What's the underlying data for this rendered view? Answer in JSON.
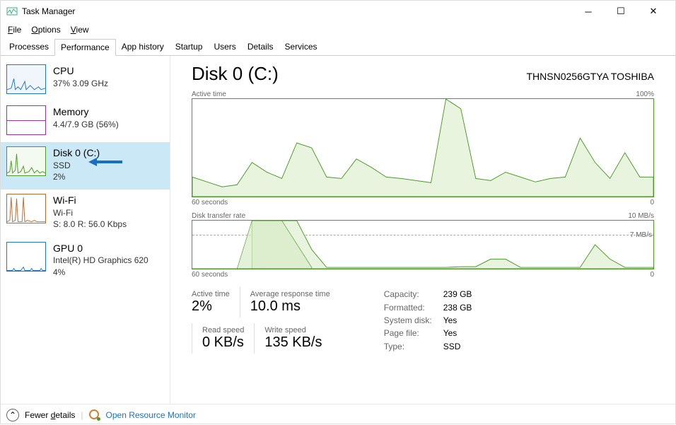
{
  "window": {
    "title": "Task Manager",
    "menus": {
      "file": "File",
      "options": "Options",
      "view": "View"
    }
  },
  "tabs": [
    "Processes",
    "Performance",
    "App history",
    "Startup",
    "Users",
    "Details",
    "Services"
  ],
  "activeTab": "Performance",
  "sidebar": [
    {
      "id": "cpu",
      "title": "CPU",
      "line1": "37%  3.09 GHz",
      "line2": "",
      "color": "#2176c5"
    },
    {
      "id": "memory",
      "title": "Memory",
      "line1": "4.4/7.9 GB (56%)",
      "line2": "",
      "color": "#9435a6"
    },
    {
      "id": "disk0",
      "title": "Disk 0 (C:)",
      "line1": "SSD",
      "line2": "2%",
      "color": "#4c9a2a",
      "selected": true
    },
    {
      "id": "wifi",
      "title": "Wi-Fi",
      "line1": "Wi-Fi",
      "line2": "S: 8.0  R: 56.0 Kbps",
      "color": "#b56c32"
    },
    {
      "id": "gpu0",
      "title": "GPU 0",
      "line1": "Intel(R) HD Graphics 620",
      "line2": "4%",
      "color": "#2176c5"
    }
  ],
  "main": {
    "title": "Disk 0 (C:)",
    "model": "THNSN0256GTYA TOSHIBA",
    "chart1": {
      "topLeft": "Active time",
      "topRight": "100%",
      "bottomLeft": "60 seconds",
      "bottomRight": "0"
    },
    "chart2": {
      "topLeft": "Disk transfer rate",
      "topRight": "10 MB/s",
      "midRight": "7 MB/s",
      "bottomLeft": "60 seconds",
      "bottomRight": "0"
    },
    "stats1": [
      {
        "label": "Active time",
        "value": "2%"
      },
      {
        "label": "Average response time",
        "value": "10.0 ms"
      }
    ],
    "stats2": [
      {
        "label": "Read speed",
        "value": "0 KB/s"
      },
      {
        "label": "Write speed",
        "value": "135 KB/s"
      }
    ],
    "props": [
      {
        "k": "Capacity:",
        "v": "239 GB"
      },
      {
        "k": "Formatted:",
        "v": "238 GB"
      },
      {
        "k": "System disk:",
        "v": "Yes"
      },
      {
        "k": "Page file:",
        "v": "Yes"
      },
      {
        "k": "Type:",
        "v": "SSD"
      }
    ]
  },
  "footer": {
    "fewer": "Fewer details",
    "resmon": "Open Resource Monitor"
  },
  "chart_data": [
    {
      "type": "area",
      "title": "Active time",
      "xlabel": "seconds",
      "ylabel": "Active time (%)",
      "xlim": [
        60,
        0
      ],
      "ylim": [
        0,
        100
      ],
      "x_seconds_ago": [
        60,
        58,
        56,
        54,
        52,
        50,
        48,
        46,
        44,
        42,
        40,
        38,
        36,
        34,
        32,
        30,
        28,
        26,
        24,
        22,
        20,
        18,
        16,
        14,
        12,
        10,
        8,
        6,
        4,
        2,
        0
      ],
      "values_pct": [
        20,
        15,
        10,
        12,
        35,
        25,
        18,
        55,
        50,
        20,
        18,
        38,
        30,
        20,
        18,
        16,
        14,
        100,
        90,
        18,
        16,
        25,
        20,
        15,
        18,
        20,
        60,
        35,
        18,
        45,
        20
      ]
    },
    {
      "type": "area",
      "title": "Disk transfer rate",
      "xlabel": "seconds",
      "ylabel": "MB/s",
      "xlim": [
        60,
        0
      ],
      "ylim": [
        0,
        10
      ],
      "reference_line": 7,
      "series": [
        {
          "name": "read",
          "values_mbps": [
            0,
            0,
            0,
            0,
            0,
            0,
            0,
            0,
            0,
            0,
            0,
            0,
            0,
            0,
            0,
            0,
            0,
            0,
            0,
            0,
            0,
            0,
            0,
            0,
            0,
            0,
            0,
            0,
            0,
            0,
            0
          ]
        },
        {
          "name": "write",
          "values_mbps": [
            0,
            0,
            0,
            0,
            10,
            10,
            10,
            4,
            0.2,
            0.3,
            0.2,
            0.2,
            0.2,
            0.2,
            0.2,
            0.2,
            0.2,
            0.4,
            0.3,
            2,
            2,
            0.3,
            0.2,
            0.3,
            0.2,
            0.2,
            5,
            2,
            0.3,
            0.4,
            0.3
          ]
        }
      ]
    }
  ]
}
